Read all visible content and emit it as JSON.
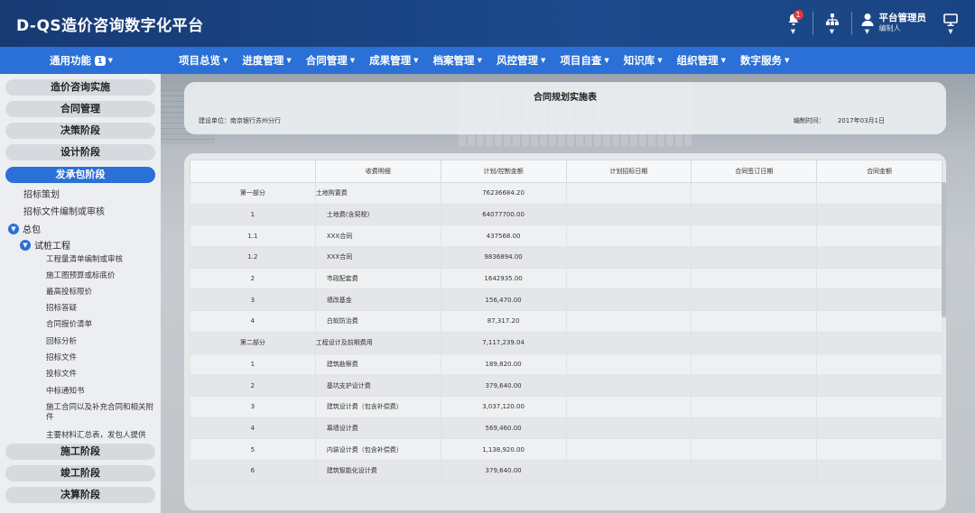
{
  "header": {
    "title": "D-QS造价咨询数字化平台",
    "bell_badge": "1",
    "user_name": "平台管理员",
    "user_role": "编制人"
  },
  "nav": {
    "common": "通用功能",
    "common_badge": "1",
    "items": [
      "项目总览",
      "进度管理",
      "合同管理",
      "成果管理",
      "档案管理",
      "风控管理",
      "项目自查",
      "知识库",
      "组织管理",
      "数字服务"
    ]
  },
  "sidebar": {
    "groups_top": [
      "造价咨询实施",
      "合同管理",
      "决策阶段",
      "设计阶段"
    ],
    "active_group": "发承包阶段",
    "leaves_l2": [
      "招标策划",
      "招标文件编制或审核"
    ],
    "node_l2": "总包",
    "node_l3": "试桩工程",
    "leaves_l4": [
      "工程量清单编制或审核",
      "施工图预算或标底价",
      "最高投标限价",
      "招标答疑",
      "合同报价清单",
      "回标分析",
      "招标文件",
      "投标文件",
      "中标通知书",
      "施工合同以及补充合同和相关附件",
      "主要材料汇总表，发包人提供"
    ],
    "groups_bottom": [
      "施工阶段",
      "竣工阶段",
      "决算阶段"
    ]
  },
  "doc": {
    "title": "合同规划实施表",
    "unit_label": "建设单位：南京银行苏州分行",
    "date_label": "编制时间：",
    "date_value": "2017年03月1日"
  },
  "table": {
    "headers": [
      "",
      "收费明细",
      "计划/控制金额",
      "计划招标日期",
      "合同签订日期",
      "合同金额"
    ],
    "rows": [
      {
        "no": "第一部分",
        "name": "土地购置费",
        "amount": "76236684.20",
        "kind": "head"
      },
      {
        "no": "1",
        "name": "土地费(含契税)",
        "amount": "64077700.00",
        "kind": "sub"
      },
      {
        "no": "1.1",
        "name": "XXX合同",
        "amount": "437568.00",
        "kind": "sub"
      },
      {
        "no": "1.2",
        "name": "XXX合同",
        "amount": "9836894.00",
        "kind": "sub"
      },
      {
        "no": "2",
        "name": "市政配套费",
        "amount": "1642935.00",
        "kind": "sub"
      },
      {
        "no": "3",
        "name": "墙改基金",
        "amount": "156,470.00",
        "kind": "sub"
      },
      {
        "no": "4",
        "name": "白蚁防治费",
        "amount": "87,317.20",
        "kind": "sub"
      },
      {
        "no": "第二部分",
        "name": "工程设计及前期费用",
        "amount": "7,117,239.04",
        "kind": "head"
      },
      {
        "no": "1",
        "name": "建筑勘察费",
        "amount": "189,820.00",
        "kind": "sub"
      },
      {
        "no": "2",
        "name": "基坑支护设计费",
        "amount": "379,640.00",
        "kind": "sub"
      },
      {
        "no": "3",
        "name": "建筑设计费（包含补偿费）",
        "amount": "3,037,120.00",
        "kind": "sub"
      },
      {
        "no": "4",
        "name": "幕墙设计费",
        "amount": "569,460.00",
        "kind": "sub"
      },
      {
        "no": "5",
        "name": "内装设计费（包含补偿费）",
        "amount": "1,138,920.00",
        "kind": "sub"
      },
      {
        "no": "6",
        "name": "建筑智能化设计费",
        "amount": "379,640.00",
        "kind": "sub"
      }
    ]
  }
}
